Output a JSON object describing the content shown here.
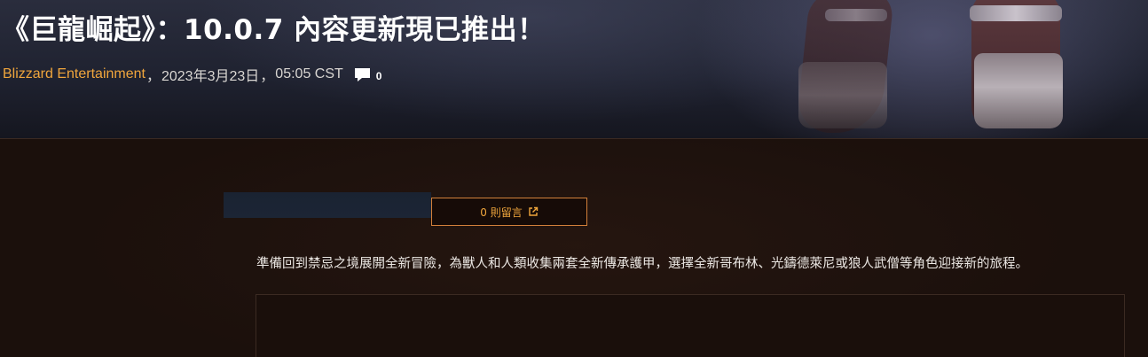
{
  "article": {
    "title": "《巨龍崛起》：10.0.7 內容更新現已推出！",
    "author": "Blizzard Entertainment",
    "meta_sep1": "，",
    "date": "2023年3月23日",
    "meta_sep2": "，",
    "time": "05:05 CST",
    "comment_count": "0",
    "intro": "準備回到禁忌之境展開全新冒險，為獸人和人類收集兩套全新傳承護甲，選擇全新哥布林、光鑄德萊尼或狼人武僧等角色迎接新的旅程。"
  },
  "comments_button": {
    "label": "0 則留言"
  },
  "icons": {
    "comment": "comment-bubble-icon",
    "external": "external-link-icon"
  },
  "colors": {
    "accent": "#f0a63c",
    "button_border": "#d2803a",
    "background": "#1b100c",
    "title": "#ffffff"
  }
}
